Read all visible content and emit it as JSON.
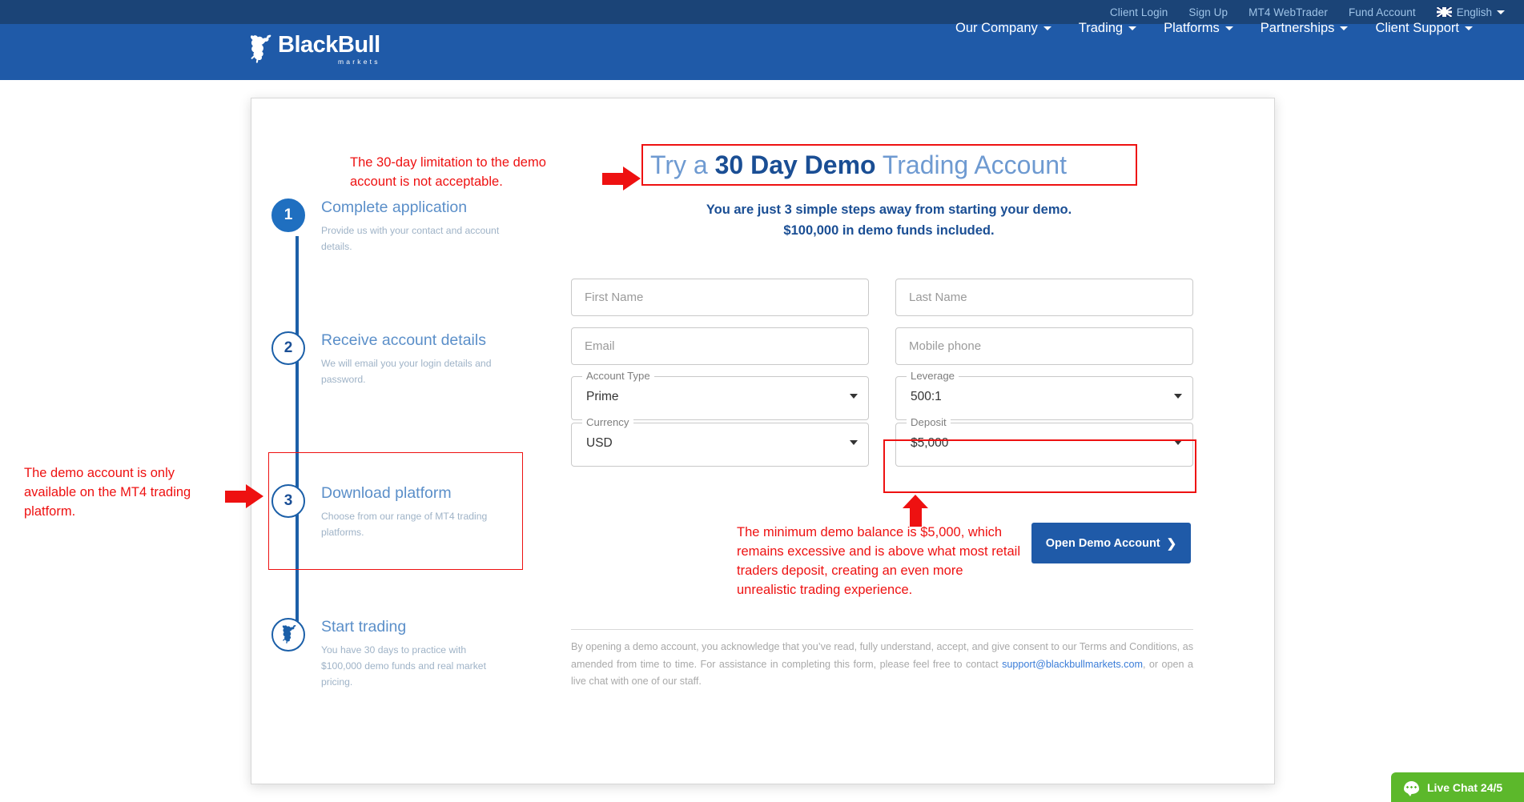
{
  "topbar": {
    "links": [
      "Client Login",
      "Sign Up",
      "MT4 WebTrader",
      "Fund Account"
    ],
    "language": "English",
    "flag_icon": "uk-flag-icon"
  },
  "brand": {
    "name": "BlackBull",
    "tagline": "markets"
  },
  "nav": {
    "items": [
      "Our Company",
      "Trading",
      "Platforms",
      "Partnerships",
      "Client Support"
    ]
  },
  "hero": {
    "headline_prefix": "Try a ",
    "headline_bold": "30 Day Demo",
    "headline_suffix": " Trading Account",
    "subline_1": "You are just 3 simple steps away from starting your demo.",
    "subline_2": "$100,000 in demo funds included."
  },
  "steps": [
    {
      "number": "1",
      "title": "Complete application",
      "desc": "Provide us with your contact and account details."
    },
    {
      "number": "2",
      "title": "Receive account details",
      "desc": "We will email you your login details and password."
    },
    {
      "number": "3",
      "title": "Download platform",
      "desc": "Choose from our range of MT4 trading platforms."
    },
    {
      "number": "bull-icon",
      "title": "Start trading",
      "desc": "You have 30 days to practice with $100,000 demo funds and real market pricing."
    }
  ],
  "form": {
    "first_name_placeholder": "First Name",
    "last_name_placeholder": "Last Name",
    "email_placeholder": "Email",
    "mobile_placeholder": "Mobile phone",
    "account_type_label": "Account Type",
    "account_type_value": "Prime",
    "leverage_label": "Leverage",
    "leverage_value": "500:1",
    "currency_label": "Currency",
    "currency_value": "USD",
    "deposit_label": "Deposit",
    "deposit_value": "$5,000",
    "submit_label": "Open Demo Account",
    "submit_chevron": "❯"
  },
  "disclaimer": {
    "part1": "By opening a demo account, you acknowledge that you’ve read, fully understand, accept, and give consent to our Terms and Conditions, as amended from time to time. For assistance in completing this form, please feel free to contact ",
    "email": "support@blackbullmarkets.com",
    "part2": ", or open a live chat with one of our staff."
  },
  "annotations": {
    "top": "The 30-day limitation to the demo account is not acceptable.",
    "left": "The demo account is only available on the MT4 trading platform.",
    "bottom": "The minimum demo balance is $5,000, which remains excessive and is above what most retail traders deposit, creating an even more unrealistic trading experience.",
    "color": "#ee1111"
  },
  "livechat": {
    "label": "Live Chat 24/5",
    "color": "#5cb82b"
  },
  "colors": {
    "topbar": "#1b4477",
    "navbar": "#1f5aa8",
    "accent": "#1a4e94",
    "cta": "#1f5aa8"
  }
}
